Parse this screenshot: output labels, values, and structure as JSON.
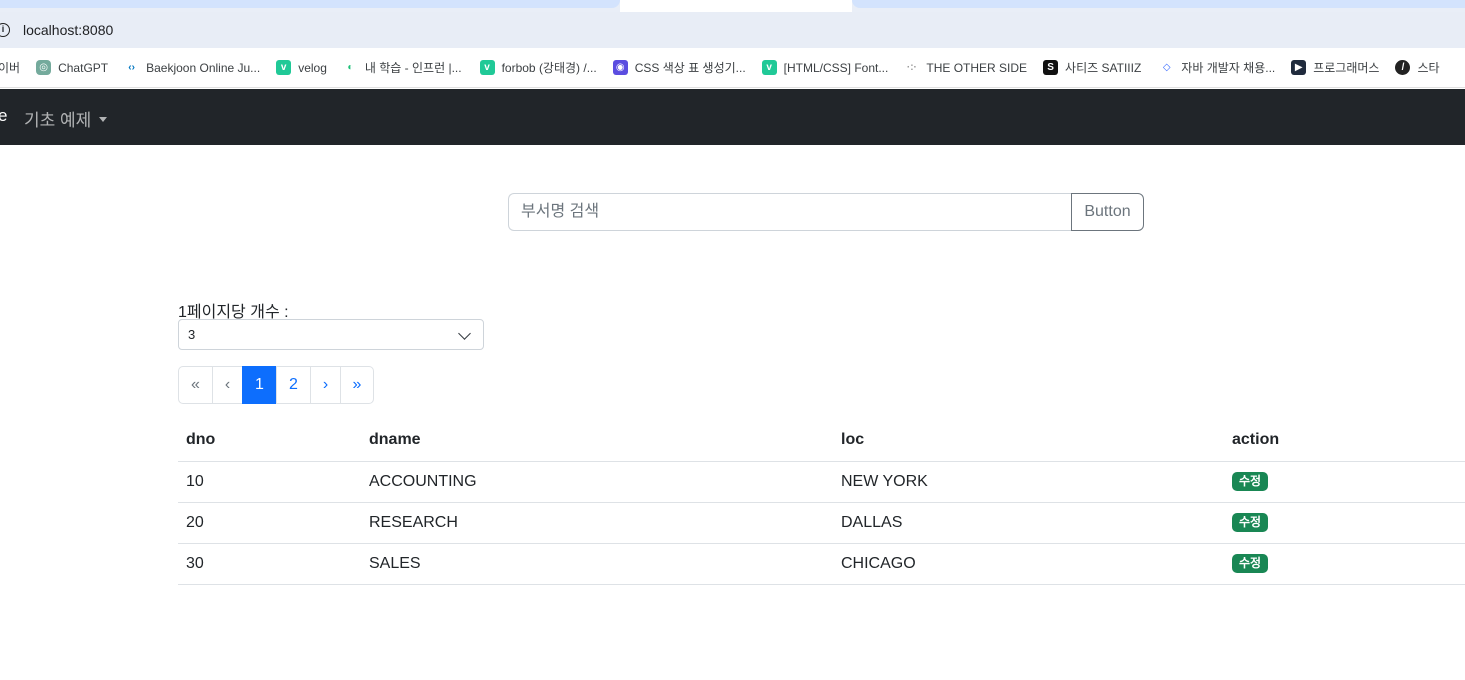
{
  "browser": {
    "url": "localhost:8080",
    "bookmarks": [
      {
        "label": "이버",
        "icon": "naver-icon",
        "color": "#ffffff"
      },
      {
        "label": "ChatGPT",
        "icon": "chatgpt-icon",
        "color": "#74aa9c"
      },
      {
        "label": "Baekjoon Online Ju...",
        "icon": "code-icon",
        "color": "#0076c0"
      },
      {
        "label": "velog",
        "icon": "velog-icon",
        "color": "#20c997"
      },
      {
        "label": "내 학습 - 인프런 |...",
        "icon": "inflearn-icon",
        "color": "#1dc078"
      },
      {
        "label": "forbob (강태경) /...",
        "icon": "velog-icon",
        "color": "#20c997"
      },
      {
        "label": "CSS 색상 표 생성기...",
        "icon": "palette-icon",
        "color": "#5b4de0"
      },
      {
        "label": "[HTML/CSS] Font...",
        "icon": "velog-icon",
        "color": "#20c997"
      },
      {
        "label": "THE OTHER SIDE",
        "icon": "dots-icon",
        "color": "#999999"
      },
      {
        "label": "사티즈 SATIIIZ",
        "icon": "s-icon",
        "color": "#111111"
      },
      {
        "label": "자바 개발자 채용...",
        "icon": "wanted-icon",
        "color": "#3366ff"
      },
      {
        "label": "프로그래머스",
        "icon": "programmers-icon",
        "color": "#202b3d"
      },
      {
        "label": "스타",
        "icon": "pen-icon",
        "color": "#222222"
      }
    ]
  },
  "navbar": {
    "brand": "e",
    "dropdown_label": "기초 예제"
  },
  "search": {
    "placeholder": "부서명 검색",
    "button_label": "Button"
  },
  "perpage": {
    "label": "1페이지당 개수 :",
    "selected": "3"
  },
  "pagination": {
    "first": "«",
    "prev": "‹",
    "pages": [
      "1",
      "2"
    ],
    "active_page": "1",
    "next": "›",
    "last": "»"
  },
  "table": {
    "headers": [
      "dno",
      "dname",
      "loc",
      "action"
    ],
    "rows": [
      {
        "dno": "10",
        "dname": "ACCOUNTING",
        "loc": "NEW YORK",
        "action": "수정"
      },
      {
        "dno": "20",
        "dname": "RESEARCH",
        "loc": "DALLAS",
        "action": "수정"
      },
      {
        "dno": "30",
        "dname": "SALES",
        "loc": "CHICAGO",
        "action": "수정"
      }
    ]
  },
  "colors": {
    "navbar_bg": "#212529",
    "primary": "#0d6efd",
    "success": "#198754"
  }
}
